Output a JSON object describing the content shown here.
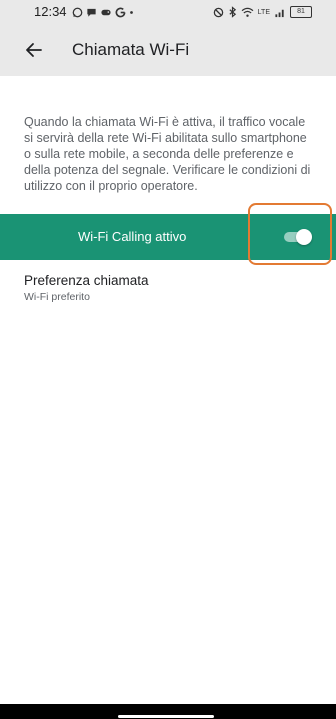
{
  "status_bar": {
    "time": "12:34",
    "left_icons": [
      "whatsapp-icon",
      "chat-icon",
      "game-icon",
      "google-icon",
      "dot-icon"
    ],
    "right_icons": [
      "nfc-icon",
      "bluetooth-icon",
      "wifi-icon",
      "lte-signal-icon",
      "battery-icon"
    ],
    "lte_label": "LTE",
    "battery_level": "81"
  },
  "app_bar": {
    "title": "Chiamata Wi-Fi"
  },
  "description": "Quando la chiamata Wi-Fi è attiva, il traffico vocale si servirà della rete Wi-Fi abilitata sullo smartphone o sulla rete mobile, a seconda delle preferenze e della potenza del segnale. Verificare le condizioni di utilizzo con il proprio operatore.",
  "wifi_calling": {
    "label": "Wi-Fi Calling attivo",
    "enabled": true
  },
  "preference": {
    "title": "Preferenza chiamata",
    "value": "Wi-Fi preferito"
  },
  "colors": {
    "accent": "#1a9374",
    "highlight": "#e37a33",
    "bar_background": "#e9e9e9"
  }
}
